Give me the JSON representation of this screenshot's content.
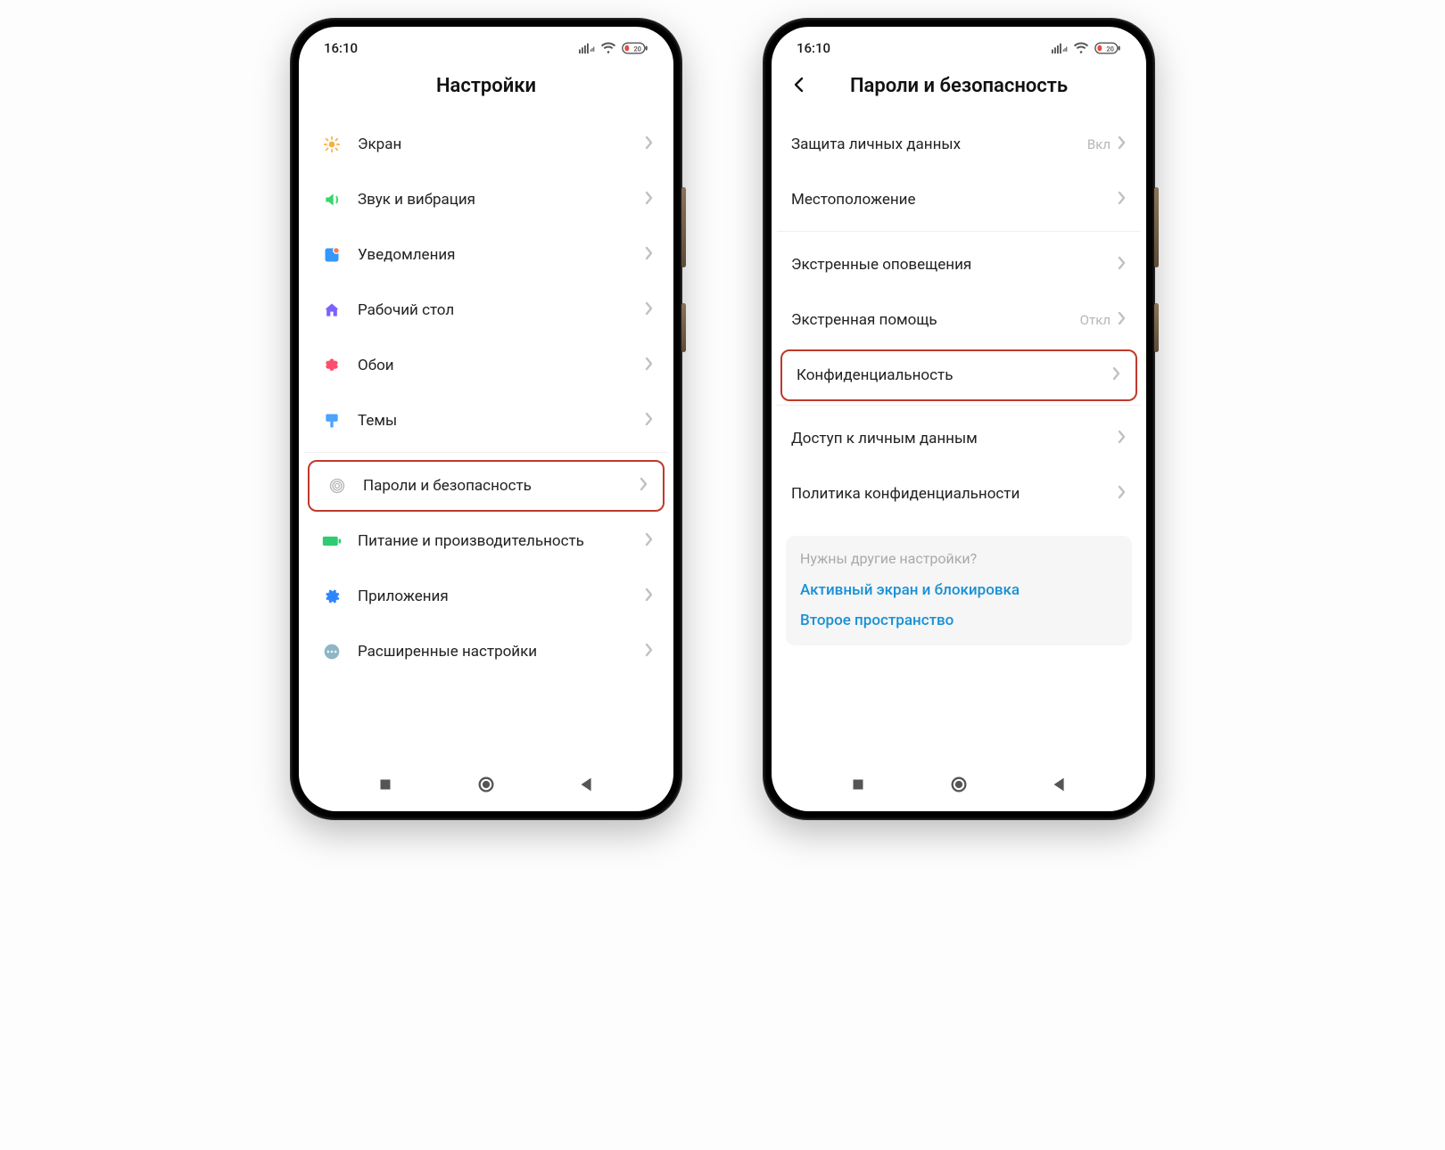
{
  "status": {
    "time": "16:10",
    "battery": "20"
  },
  "left": {
    "title": "Настройки",
    "items": [
      {
        "label": "Экран"
      },
      {
        "label": "Звук и вибрация"
      },
      {
        "label": "Уведомления"
      },
      {
        "label": "Рабочий стол"
      },
      {
        "label": "Обои"
      },
      {
        "label": "Темы"
      }
    ],
    "section2": [
      {
        "label": "Пароли и безопасность"
      },
      {
        "label": "Питание и производительность"
      },
      {
        "label": "Приложения"
      },
      {
        "label": "Расширенные настройки"
      }
    ]
  },
  "right": {
    "title": "Пароли и безопасность",
    "section1": [
      {
        "label": "Защита личных данных",
        "value": "Вкл"
      },
      {
        "label": "Местоположение"
      }
    ],
    "section2": [
      {
        "label": "Экстренные оповещения"
      },
      {
        "label": "Экстренная помощь",
        "value": "Откл"
      },
      {
        "label": "Конфиденциальность"
      }
    ],
    "section3": [
      {
        "label": "Доступ к личным данным"
      },
      {
        "label": "Политика конфиденциальности"
      }
    ],
    "suggest": {
      "question": "Нужны другие настройки?",
      "links": [
        "Активный экран и блокировка",
        "Второе пространство"
      ]
    }
  }
}
